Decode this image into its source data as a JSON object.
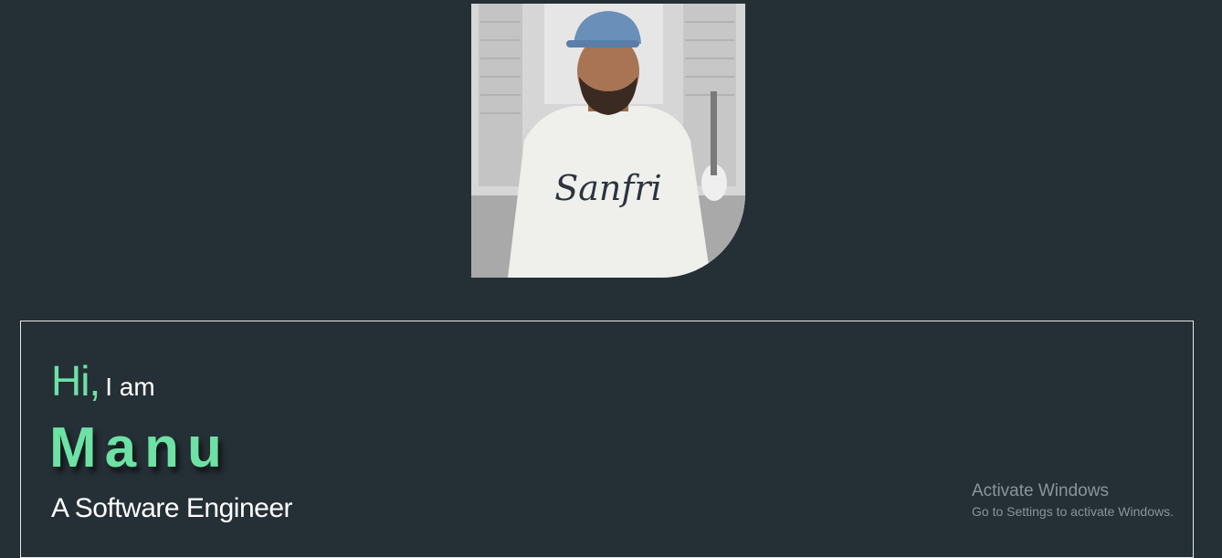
{
  "hero": {
    "photo_alt": "Profile photo of Manu",
    "shirt_text": "Sanfri"
  },
  "intro": {
    "greeting_hi": "Hi,",
    "greeting_rest": "I am",
    "name": "Manu",
    "role": "A Software Engineer"
  },
  "os_watermark": {
    "title": "Activate Windows",
    "subtitle": "Go to Settings to activate Windows."
  },
  "colors": {
    "background": "#252f36",
    "accent": "#6ee1a4",
    "text": "#ffffff",
    "card_border": "#e8e8e8"
  }
}
